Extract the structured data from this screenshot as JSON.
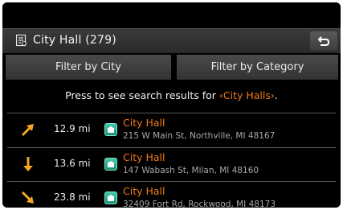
{
  "header": {
    "title": "City Hall (279)"
  },
  "filters": {
    "city_label": "Filter by City",
    "category_label": "Filter by Category"
  },
  "info": {
    "prefix": "Press to see search results for",
    "highlight": "‹City Halls›",
    "suffix": "."
  },
  "results": [
    {
      "direction_icon": "arrow-northeast-icon",
      "distance": "12.9 mi",
      "name": "City Hall",
      "address": "215 W Main St, Northville, MI 48167"
    },
    {
      "direction_icon": "arrow-south-icon",
      "distance": "13.6 mi",
      "name": "City Hall",
      "address": "147 Wabash St, Milan, MI 48160"
    },
    {
      "direction_icon": "arrow-southeast-icon",
      "distance": "23.8 mi",
      "name": "City Hall",
      "address": "32409 Fort Rd, Rockwood, MI 48173"
    }
  ],
  "colors": {
    "accent": "#f07a1a",
    "poi": "#2fb897",
    "background": "#000000"
  }
}
